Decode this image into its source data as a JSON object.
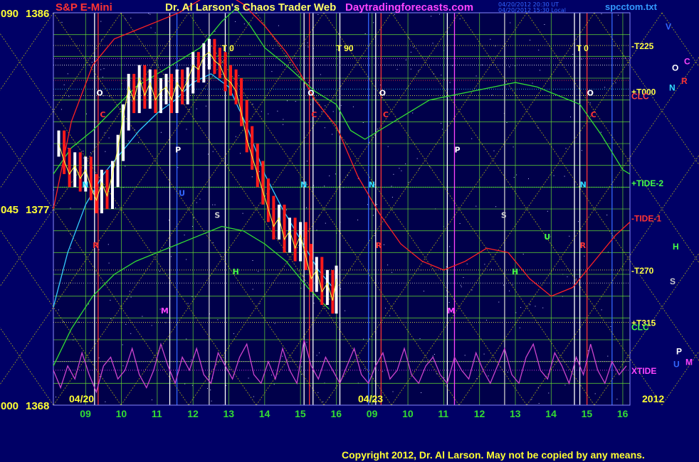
{
  "header": {
    "title": "S&P E-Mini",
    "center_title": "Dr. Al Larson's Chaos Trader Web",
    "site": "Daytradingforecasts.com",
    "stamp_ut": "04/20/2012 20:30 UT",
    "stamp_local": "04/20/2012 15:30 Local",
    "filename": "spcctom.txt"
  },
  "copyright": "Copyright 2012, Dr. Al Larson. May not be copied by any means.",
  "colors": {
    "background": "#000066",
    "plot_background": "#00004a",
    "price_up": "#ffffff",
    "price_down": "#ff1a1a",
    "yellow_grid": "#e6e600",
    "green_grid": "#66dd33",
    "xtide": "#cc44cc"
  },
  "chart_data": {
    "type": "line",
    "title": "S&P E-Mini",
    "y_ticks": [
      {
        "angle": "090",
        "price": 1386
      },
      {
        "angle": "045",
        "price": 1377
      },
      {
        "angle": "000",
        "price": 1368
      }
    ],
    "ylim": [
      1368,
      1386
    ],
    "x_hour_ticks": [
      "09",
      "10",
      "11",
      "12",
      "13",
      "14",
      "15",
      "16",
      "09",
      "10",
      "11",
      "12",
      "13",
      "14",
      "15",
      "16"
    ],
    "date_labels": [
      "04/20",
      "04/23"
    ],
    "year_label": "2012",
    "top_markers": [
      "T 0",
      "T 90",
      "T 0"
    ],
    "right_labels": [
      {
        "text": "V",
        "color": "#3366ff",
        "price": 1385.4
      },
      {
        "text": "-T225",
        "color": "#ffff44",
        "price": 1384.5
      },
      {
        "text": "C",
        "color": "#ff44ff",
        "price": 1383.8
      },
      {
        "text": "O",
        "color": "#ffffff",
        "price": 1383.5
      },
      {
        "text": "R",
        "color": "#ff3333",
        "price": 1382.9
      },
      {
        "text": "N",
        "color": "#33ddff",
        "price": 1382.6
      },
      {
        "text": "+T000",
        "color": "#ffff44",
        "price": 1382.4
      },
      {
        "text": "CLC",
        "color": "#ff4444",
        "price": 1382.2
      },
      {
        "text": "+TIDE-2",
        "color": "#44ff44",
        "price": 1378.2
      },
      {
        "text": "-TIDE-1",
        "color": "#ff3333",
        "price": 1376.6
      },
      {
        "text": "H",
        "color": "#44ff44",
        "price": 1375.3
      },
      {
        "text": "-T270",
        "color": "#ffff44",
        "price": 1374.2
      },
      {
        "text": "S",
        "color": "#cccccc",
        "price": 1373.7
      },
      {
        "text": "+T315",
        "color": "#ffff44",
        "price": 1371.8
      },
      {
        "text": "CLC",
        "color": "#44ff44",
        "price": 1371.6
      },
      {
        "text": "P",
        "color": "#ffffff",
        "price": 1370.5
      },
      {
        "text": "M",
        "color": "#ff44ff",
        "price": 1370.0
      },
      {
        "text": "U",
        "color": "#3366ff",
        "price": 1369.9
      },
      {
        "text": "XTIDE",
        "color": "#ff44ff",
        "price": 1369.6
      }
    ],
    "series": [
      {
        "name": "",
        "kind": "price",
        "x": [
          8.25,
          8.4,
          8.55,
          8.7,
          8.85,
          9.0,
          9.15,
          9.3,
          9.45,
          9.6,
          9.75,
          9.9,
          10.05,
          10.2,
          10.35,
          10.5,
          10.65,
          10.8,
          10.95,
          11.1,
          11.25,
          11.4,
          11.55,
          11.7,
          11.85,
          12.0,
          12.15,
          12.3,
          12.45,
          12.6,
          12.75,
          12.9,
          13.05,
          13.2,
          13.35,
          13.5,
          13.65,
          13.8,
          13.95,
          14.1,
          14.25,
          14.4,
          14.55,
          14.7,
          14.85,
          15.0,
          15.15,
          15.3,
          15.45,
          15.6,
          15.75,
          15.9,
          16.0
        ],
        "values": [
          1380.0,
          1379.2,
          1378.6,
          1379.0,
          1378.4,
          1378.8,
          1378.0,
          1377.4,
          1378.2,
          1377.6,
          1378.6,
          1379.8,
          1381.2,
          1382.6,
          1382.0,
          1383.0,
          1382.2,
          1382.8,
          1382.0,
          1382.4,
          1382.6,
          1382.0,
          1382.8,
          1382.4,
          1382.9,
          1383.6,
          1383.4,
          1384.0,
          1384.2,
          1383.8,
          1383.6,
          1383.0,
          1382.8,
          1382.4,
          1381.4,
          1380.2,
          1379.4,
          1378.6,
          1377.8,
          1377.0,
          1376.2,
          1376.6,
          1375.6,
          1376.0,
          1375.2,
          1375.8,
          1374.8,
          1373.8,
          1374.2,
          1373.2,
          1373.6,
          1372.8,
          1373.8
        ]
      },
      {
        "name": "",
        "kind": "flux-cyan",
        "x": [
          8.1,
          8.5,
          9.0,
          9.5,
          10.0,
          10.5,
          11.0,
          11.5,
          12.0,
          12.5,
          13.0,
          13.5,
          14.0,
          14.5,
          15.0,
          15.5,
          16.0
        ],
        "values": [
          1372.5,
          1375.0,
          1377.2,
          1378.6,
          1379.6,
          1380.6,
          1381.4,
          1382.0,
          1382.8,
          1383.2,
          1382.6,
          1380.8,
          1378.6,
          1377.0,
          1375.6,
          1374.2,
          1373.2
        ]
      },
      {
        "name": "",
        "kind": "flux-red",
        "x": [
          8.1,
          8.6,
          9.2,
          9.8,
          10.4,
          11.0,
          11.6,
          12.2,
          12.8,
          13.4,
          14.0,
          14.6,
          15.0,
          15.4,
          16.0,
          16.6,
          17.2,
          17.8,
          18.4,
          19.0,
          19.6,
          20.2,
          20.8,
          21.4,
          22.0,
          22.6,
          23.2,
          23.8,
          24.2
        ],
        "values": [
          1377.0,
          1381.0,
          1383.6,
          1384.8,
          1385.2,
          1385.6,
          1386.0,
          1386.6,
          1387.0,
          1386.4,
          1385.4,
          1384.2,
          1383.2,
          1382.0,
          1380.8,
          1378.5,
          1376.8,
          1375.4,
          1374.6,
          1374.2,
          1374.6,
          1375.2,
          1375.0,
          1373.8,
          1373.0,
          1373.4,
          1374.6,
          1375.8,
          1376.4
        ]
      },
      {
        "name": "",
        "kind": "flux-green",
        "x": [
          8.1,
          8.6,
          9.2,
          9.8,
          10.4,
          11.0,
          11.6,
          12.2,
          12.8,
          13.2,
          13.6,
          14.0,
          14.6,
          15.0,
          15.4,
          16.0,
          16.4,
          16.8,
          17.4,
          18.0,
          18.6,
          19.2,
          19.8,
          20.4,
          21.0,
          21.6,
          22.2,
          22.8,
          23.4,
          24.0,
          24.2
        ],
        "values": [
          1378.6,
          1379.8,
          1380.6,
          1381.6,
          1382.6,
          1383.2,
          1383.8,
          1384.4,
          1385.6,
          1386.2,
          1385.4,
          1384.4,
          1383.6,
          1383.0,
          1382.4,
          1381.8,
          1380.6,
          1380.2,
          1380.8,
          1381.4,
          1382.0,
          1382.2,
          1382.4,
          1382.6,
          1382.8,
          1382.6,
          1382.2,
          1381.8,
          1380.4,
          1378.8,
          1378.6
        ]
      },
      {
        "name": "",
        "kind": "flux-green-lower",
        "x": [
          8.1,
          8.6,
          9.2,
          9.8,
          10.4,
          11.0,
          11.6,
          12.2,
          12.8,
          13.4,
          14.0,
          14.6,
          15.2,
          15.8
        ],
        "values": [
          1369.8,
          1371.5,
          1373.0,
          1374.0,
          1374.6,
          1375.0,
          1375.4,
          1375.8,
          1376.2,
          1376.0,
          1375.4,
          1374.6,
          1373.4,
          1372.4
        ]
      },
      {
        "name": "",
        "kind": "xtide",
        "x": [
          8.1,
          8.3,
          8.5,
          8.7,
          8.9,
          9.1,
          9.3,
          9.5,
          9.7,
          9.9,
          10.1,
          10.3,
          10.5,
          10.7,
          10.9,
          11.1,
          11.3,
          11.5,
          11.7,
          11.9,
          12.1,
          12.3,
          12.5,
          12.7,
          12.9,
          13.1,
          13.3,
          13.5,
          13.7,
          13.9,
          14.1,
          14.3,
          14.5,
          14.7,
          14.9,
          15.1,
          15.3,
          15.5,
          15.7,
          15.9,
          16.1,
          16.3,
          16.5,
          16.7,
          16.9,
          17.1,
          17.3,
          17.5,
          17.7,
          17.9,
          18.1,
          18.3,
          18.5,
          18.7,
          18.9,
          19.1,
          19.3,
          19.5,
          19.7,
          19.9,
          20.1,
          20.3,
          20.5,
          20.7,
          20.9,
          21.1,
          21.3,
          21.5,
          21.7,
          21.9,
          22.1,
          22.3,
          22.5,
          22.7,
          22.9,
          23.1,
          23.3,
          23.5,
          23.7,
          23.9,
          24.1
        ],
        "values": [
          1369.6,
          1368.8,
          1369.8,
          1369.2,
          1370.4,
          1369.4,
          1368.6,
          1369.8,
          1370.2,
          1369.2,
          1369.6,
          1370.6,
          1369.4,
          1368.8,
          1369.6,
          1370.8,
          1369.8,
          1369.0,
          1370.2,
          1369.6,
          1370.6,
          1369.4,
          1369.0,
          1370.4,
          1369.8,
          1369.2,
          1370.2,
          1370.8,
          1369.4,
          1369.0,
          1370.0,
          1369.2,
          1370.6,
          1369.6,
          1369.0,
          1371.0,
          1369.8,
          1369.2,
          1370.2,
          1369.6,
          1369.0,
          1369.8,
          1370.6,
          1369.4,
          1369.0,
          1369.8,
          1370.4,
          1369.2,
          1369.6,
          1370.6,
          1369.4,
          1369.0,
          1369.8,
          1370.2,
          1369.4,
          1369.0,
          1370.2,
          1369.6,
          1369.2,
          1370.4,
          1369.6,
          1369.0,
          1369.8,
          1370.6,
          1369.4,
          1369.0,
          1370.2,
          1370.8,
          1369.6,
          1369.2,
          1370.4,
          1369.8,
          1369.0,
          1370.2,
          1369.4,
          1370.8,
          1369.6,
          1369.0,
          1370.0,
          1369.4,
          1369.8
        ]
      }
    ]
  }
}
